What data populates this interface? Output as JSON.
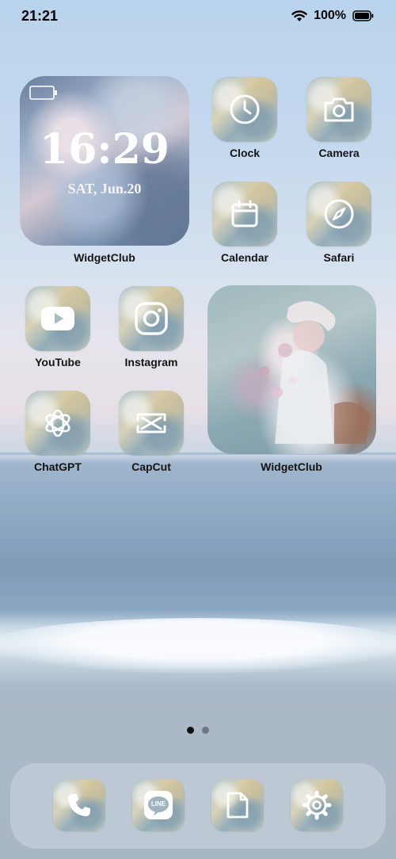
{
  "status_bar": {
    "time": "21:21",
    "battery_percent": "100%"
  },
  "clock_widget": {
    "time": "16:29",
    "date": "SAT, Jun.20",
    "label": "WidgetClub"
  },
  "apps": [
    {
      "label": "Clock",
      "icon": "clock-icon"
    },
    {
      "label": "Camera",
      "icon": "camera-icon"
    },
    {
      "label": "Calendar",
      "icon": "calendar-icon"
    },
    {
      "label": "Safari",
      "icon": "compass-icon"
    },
    {
      "label": "YouTube",
      "icon": "youtube-icon"
    },
    {
      "label": "Instagram",
      "icon": "instagram-icon"
    },
    {
      "label": "ChatGPT",
      "icon": "chatgpt-icon"
    },
    {
      "label": "CapCut",
      "icon": "capcut-icon"
    }
  ],
  "photo_widget": {
    "label": "WidgetClub"
  },
  "page_indicator": {
    "current": 1,
    "total": 2
  },
  "dock": {
    "apps": [
      {
        "icon": "phone-icon"
      },
      {
        "icon": "line-icon",
        "text": "LINE"
      },
      {
        "icon": "files-icon"
      },
      {
        "icon": "gear-icon"
      }
    ]
  },
  "colors": {
    "label_text": "#141414",
    "icon_white": "#ffffff",
    "dot_active": "#111111",
    "dot_inactive": "#6b7680"
  }
}
